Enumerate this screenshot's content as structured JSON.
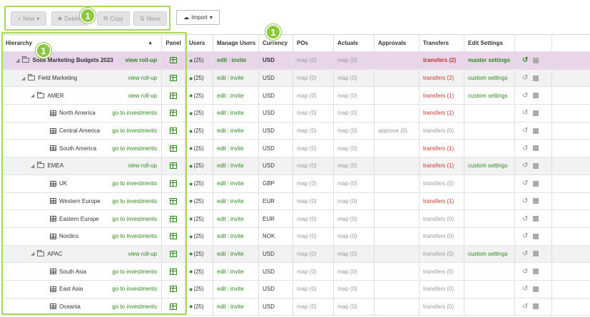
{
  "toolbar": {
    "new_label": "New",
    "delete_label": "Delete",
    "copy_label": "Copy",
    "move_label": "Move",
    "import_label": "Import"
  },
  "badges": [
    "1",
    "1",
    "1"
  ],
  "columns": {
    "hierarchy": "Hierarchy",
    "panel": "Panel",
    "users": "Users",
    "manage_users": "Manage Users",
    "currency": "Currency",
    "pos": "POs",
    "actuals": "Actuals",
    "approvals": "Approvals",
    "transfers": "Transfers",
    "edit_settings": "Edit Settings"
  },
  "rows": [
    {
      "name": "Solis Marketing Budgets 2023",
      "link": "view roll-up",
      "users": "(25)",
      "edit": "edit",
      "invite": "invite",
      "currency": "USD",
      "pos": "map (0)",
      "actuals": "map (0)",
      "approvals": "",
      "transfers": "transfers (2)",
      "settings": "master settings"
    },
    {
      "name": "Field Marketing",
      "link": "view roll-up",
      "users": "(25)",
      "edit": "edit",
      "invite": "invite",
      "currency": "USD",
      "pos": "map (0)",
      "actuals": "map (0)",
      "approvals": "",
      "transfers": "transfers (2)",
      "settings": "custom settings"
    },
    {
      "name": "AMER",
      "link": "view roll-up",
      "users": "(25)",
      "edit": "edit",
      "invite": "invite",
      "currency": "USD",
      "pos": "map (0)",
      "actuals": "map (0)",
      "approvals": "",
      "transfers": "transfers (1)",
      "settings": "custom settings"
    },
    {
      "name": "North America",
      "link": "go to investments",
      "users": "(25)",
      "edit": "edit",
      "invite": "invite",
      "currency": "USD",
      "pos": "map (0)",
      "actuals": "map (0)",
      "approvals": "",
      "transfers": "transfers (1)",
      "settings": ""
    },
    {
      "name": "Central America",
      "link": "go to investments",
      "users": "(25)",
      "edit": "edit",
      "invite": "invite",
      "currency": "USD",
      "pos": "map (0)",
      "actuals": "map (0)",
      "approvals": "approve (0)",
      "transfers": "transfers (0)",
      "settings": ""
    },
    {
      "name": "South America",
      "link": "go to investments",
      "users": "(25)",
      "edit": "edit",
      "invite": "invite",
      "currency": "USD",
      "pos": "map (0)",
      "actuals": "map (0)",
      "approvals": "",
      "transfers": "transfers (1)",
      "settings": ""
    },
    {
      "name": "EMEA",
      "link": "view roll-up",
      "users": "(25)",
      "edit": "edit",
      "invite": "invite",
      "currency": "USD",
      "pos": "map (0)",
      "actuals": "map (0)",
      "approvals": "",
      "transfers": "transfers (1)",
      "settings": "custom settings"
    },
    {
      "name": "UK",
      "link": "go to investments",
      "users": "(25)",
      "edit": "edit",
      "invite": "invite",
      "currency": "GBP",
      "pos": "map (0)",
      "actuals": "map (0)",
      "approvals": "",
      "transfers": "transfers (0)",
      "settings": ""
    },
    {
      "name": "Western Europe",
      "link": "go to investments",
      "users": "(25)",
      "edit": "edit",
      "invite": "invite",
      "currency": "EUR",
      "pos": "map (0)",
      "actuals": "map (0)",
      "approvals": "",
      "transfers": "transfers (1)",
      "settings": ""
    },
    {
      "name": "Eastern Europe",
      "link": "go to investments",
      "users": "(25)",
      "edit": "edit",
      "invite": "invite",
      "currency": "EUR",
      "pos": "map (0)",
      "actuals": "map (0)",
      "approvals": "",
      "transfers": "transfers (0)",
      "settings": ""
    },
    {
      "name": "Nordics",
      "link": "go to investments",
      "users": "(25)",
      "edit": "edit",
      "invite": "invite",
      "currency": "NOK",
      "pos": "map (0)",
      "actuals": "map (0)",
      "approvals": "",
      "transfers": "transfers (0)",
      "settings": ""
    },
    {
      "name": "APAC",
      "link": "view roll-up",
      "users": "(25)",
      "edit": "edit",
      "invite": "invite",
      "currency": "USD",
      "pos": "map (0)",
      "actuals": "map (0)",
      "approvals": "",
      "transfers": "transfers (0)",
      "settings": "custom settings"
    },
    {
      "name": "South Asia",
      "link": "go to investments",
      "users": "(25)",
      "edit": "edit",
      "invite": "invite",
      "currency": "USD",
      "pos": "map (0)",
      "actuals": "map (0)",
      "approvals": "",
      "transfers": "transfers (0)",
      "settings": ""
    },
    {
      "name": "East Asia",
      "link": "go to investments",
      "users": "(25)",
      "edit": "edit",
      "invite": "invite",
      "currency": "USD",
      "pos": "map (0)",
      "actuals": "map (0)",
      "approvals": "",
      "transfers": "transfers (0)",
      "settings": ""
    },
    {
      "name": "Oceania",
      "link": "go to investments",
      "users": "(25)",
      "edit": "edit",
      "invite": "invite",
      "currency": "USD",
      "pos": "map (0)",
      "actuals": "map (0)",
      "approvals": "",
      "transfers": "transfers (0)",
      "settings": ""
    }
  ],
  "colors": {
    "accent_green": "#2e8b1e",
    "highlight_green": "#a6d95a",
    "badge_green": "#8dc63f",
    "top_row": "#e8d5ea",
    "transfer_red": "#c0392b"
  }
}
